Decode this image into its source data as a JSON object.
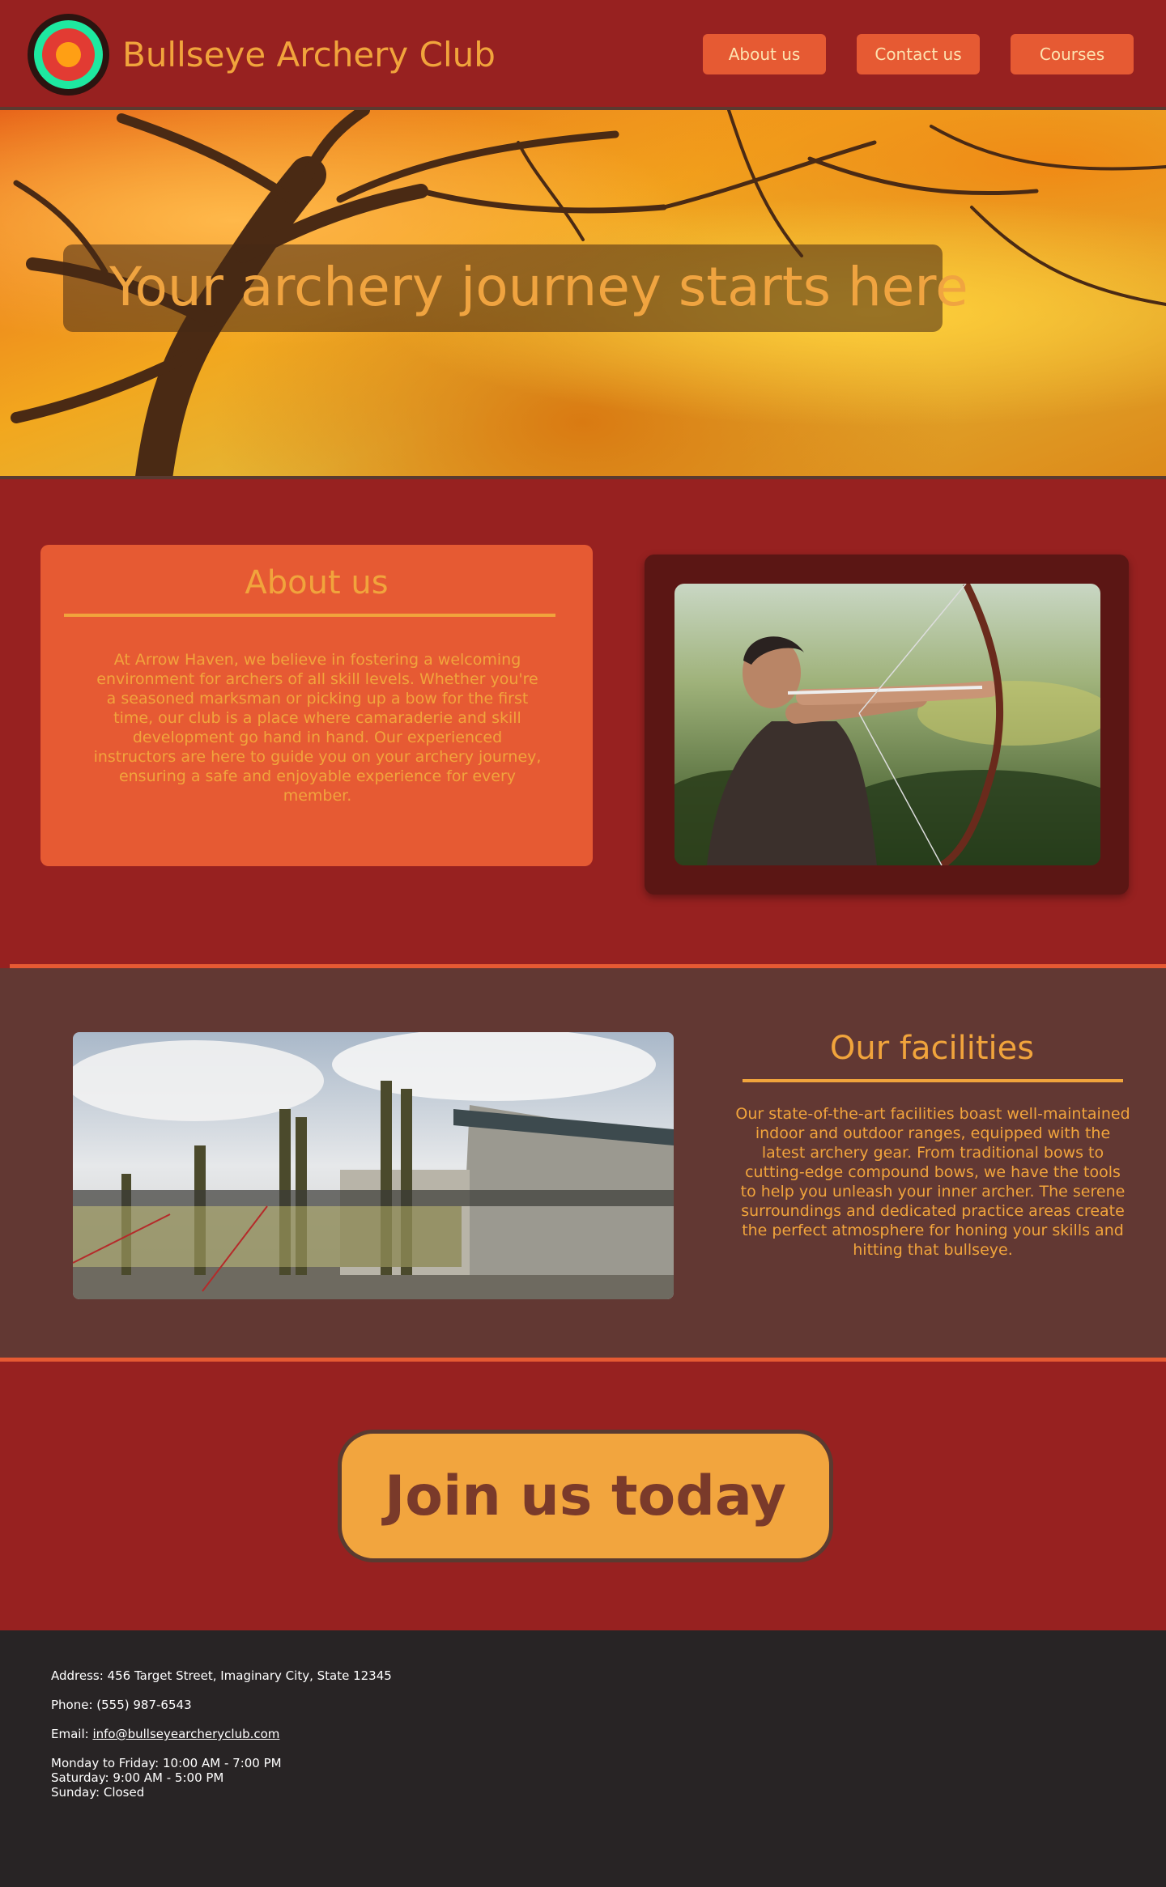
{
  "header": {
    "title": "Bullseye Archery Club",
    "logo_icon": "target-icon",
    "nav": {
      "about": "About us",
      "contact": "Contact us",
      "courses": "Courses"
    }
  },
  "hero": {
    "title": "Your archery journey starts here"
  },
  "about": {
    "title": "About us",
    "text": "At Arrow Haven, we believe in fostering a welcoming environment for archers of all skill levels. Whether you're a seasoned marksman or picking up a bow for the first time, our club is a place where camaraderie and skill development go hand in hand. Our experienced instructors are here to guide you on your archery journey, ensuring a safe and enjoyable experience for every member."
  },
  "facilities": {
    "title": "Our facilities",
    "text": "Our state-of-the-art facilities boast well-maintained indoor and outdoor ranges, equipped with the latest archery gear. From traditional bows to cutting-edge compound bows, we have the tools to help you unleash your inner archer. The serene surroundings and dedicated practice areas create the perfect atmosphere for honing your skills and hitting that bullseye."
  },
  "cta": {
    "label": "Join us today"
  },
  "footer": {
    "address": "Address: 456 Target Street, Imaginary City, State 12345",
    "phone": "Phone: (555) 987-6543",
    "email_prefix": "Email: ",
    "email": "info@bullseyearcheryclub.com",
    "hours_weekday": "Monday to Friday: 10:00 AM - 7:00 PM",
    "hours_saturday": "Saturday: 9:00 AM - 5:00 PM",
    "hours_sunday": "Sunday: Closed"
  },
  "colors": {
    "primary_bg": "#972120",
    "accent": "#e65a33",
    "text_gold": "#f1a43c",
    "facilities_bg": "#623833",
    "footer_bg": "#282425"
  }
}
